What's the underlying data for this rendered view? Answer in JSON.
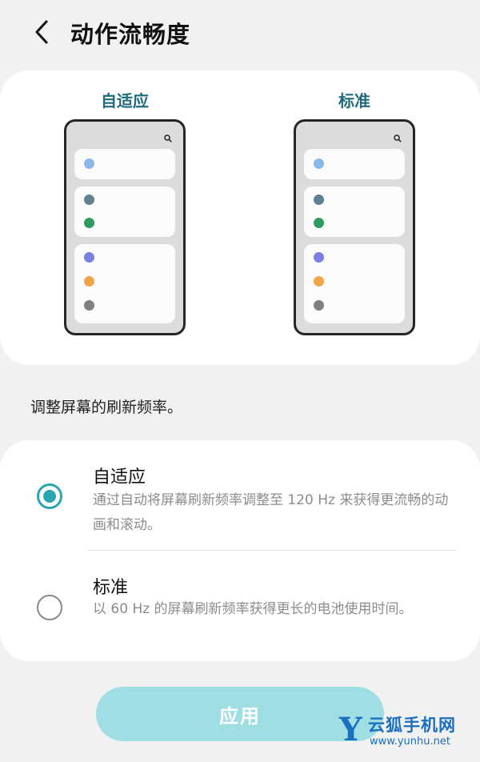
{
  "header": {
    "title": "动作流畅度",
    "back_icon": "chevron-left-icon"
  },
  "preview": {
    "items": [
      {
        "label": "自适应",
        "label_color": "#1f6b7a",
        "dots": [
          "#8ab8e8",
          "#5f8191",
          "#2f9a5d",
          "#7a7fe0",
          "#f0a54a",
          "#7f7f7f"
        ]
      },
      {
        "label": "标准",
        "label_color": "#1f6b7a",
        "dots": [
          "#8ab8e8",
          "#5f8191",
          "#2f9a5d",
          "#7a7fe0",
          "#f0a54a",
          "#7f7f7f"
        ]
      }
    ]
  },
  "description": "调整屏幕的刷新频率。",
  "options": [
    {
      "title": "自适应",
      "desc": "通过自动将屏幕刷新频率调整至 120 Hz 来获得更流畅的动画和滚动。",
      "selected": true
    },
    {
      "title": "标准",
      "desc": "以 60 Hz 的屏幕刷新频率获得更长的电池使用时间。",
      "selected": false
    }
  ],
  "apply_button": {
    "label": "应用"
  },
  "watermark": {
    "logo": "Y",
    "name": "云狐手机网",
    "url": "www.yunhu.net"
  },
  "colors": {
    "accent": "#2aa6b3",
    "apply_button_bg": "#9fdfe4",
    "watermark": "#1a6fc0"
  }
}
